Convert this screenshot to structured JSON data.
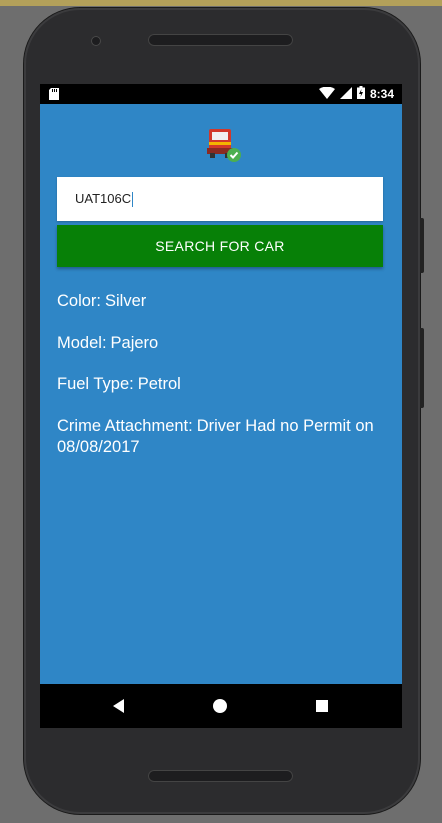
{
  "status_bar": {
    "time": "8:34",
    "icons": [
      "sd-card-icon",
      "wifi-icon",
      "signal-icon",
      "battery-icon"
    ]
  },
  "app": {
    "icon": "truck-check-icon"
  },
  "search": {
    "value": "UAT106C",
    "button_label": "SEARCH FOR CAR"
  },
  "details": {
    "color_label": "Color:",
    "color_value": "Silver",
    "model_label": "Model:",
    "model_value": "Pajero",
    "fuel_label": "Fuel Type:",
    "fuel_value": "Petrol",
    "crime_label": "Crime Attachment:",
    "crime_value": "Driver Had no Permit on 08/08/2017"
  },
  "nav": {
    "back_icon": "back-triangle-icon",
    "home_icon": "home-circle-icon",
    "recent_icon": "recents-square-icon"
  },
  "colors": {
    "screen_bg": "#2f86c6",
    "button_bg": "#078007",
    "text": "#ffffff"
  }
}
